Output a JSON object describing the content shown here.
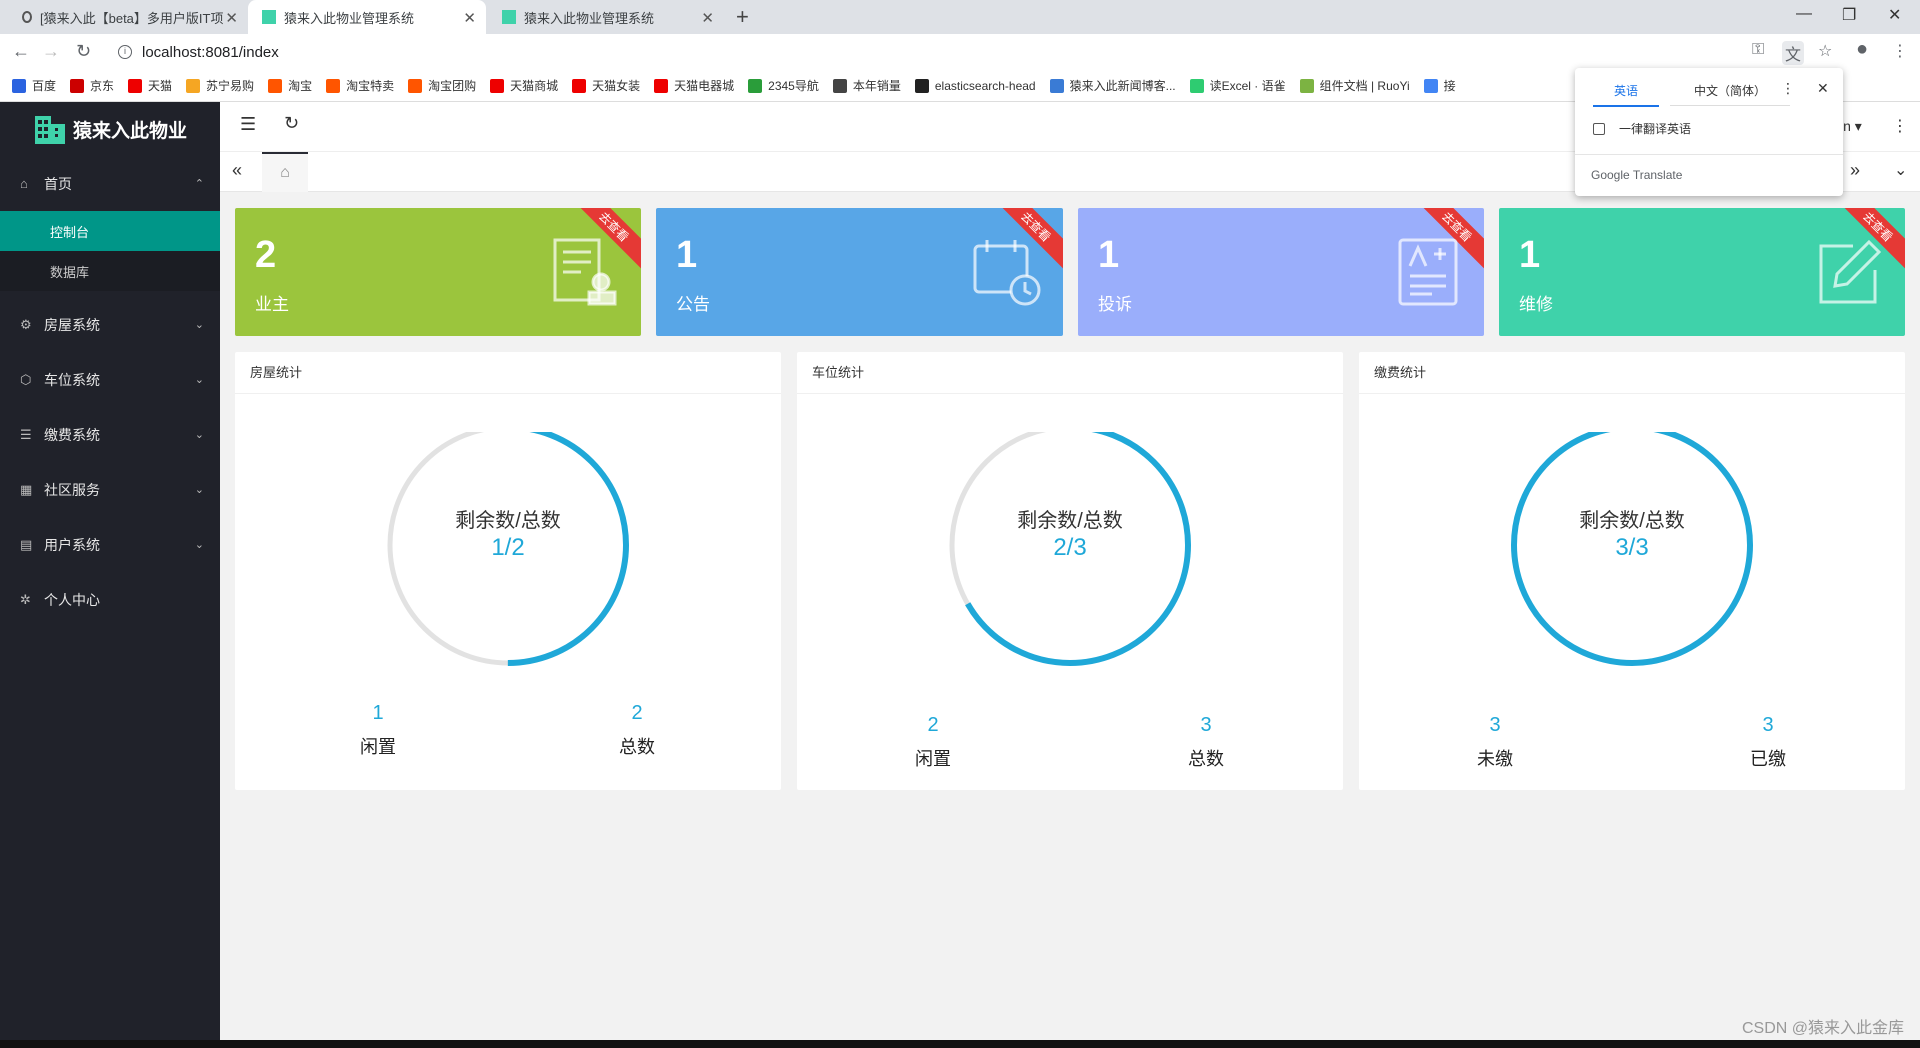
{
  "browser": {
    "tabs": [
      {
        "title": "[猿来入此【beta】多用户版IT项"
      },
      {
        "title": "猿来入此物业管理系统"
      },
      {
        "title": "猿来入此物业管理系统"
      }
    ],
    "url": "localhost:8081/index",
    "bookmarks": [
      "百度",
      "京东",
      "天猫",
      "苏宁易购",
      "淘宝",
      "淘宝特卖",
      "淘宝团购",
      "天猫商城",
      "天猫女装",
      "天猫电器城",
      "2345导航",
      "本年销量",
      "elasticsearch-head",
      "猿来入此新闻博客...",
      "读Excel · 语雀",
      "组件文档 | RuoYi",
      "接"
    ]
  },
  "translate_popup": {
    "tab_source": "英语",
    "tab_target": "中文（简体）",
    "checkbox_label": "一律翻译英语",
    "brand": "Google Translate"
  },
  "app": {
    "logo_text": "猿来入此物业",
    "menu": [
      {
        "label": "首页",
        "icon": "home-icon"
      },
      {
        "label": "房屋系统",
        "icon": "gear-icon"
      },
      {
        "label": "车位系统",
        "icon": "cube-icon"
      },
      {
        "label": "缴费系统",
        "icon": "list-icon"
      },
      {
        "label": "社区服务",
        "icon": "apps-icon"
      },
      {
        "label": "用户系统",
        "icon": "user-grid-icon"
      },
      {
        "label": "个人中心",
        "icon": "settings-icon"
      }
    ],
    "submenu": [
      "控制台",
      "数据库"
    ],
    "user_suffix": "in"
  },
  "cards": [
    {
      "num": "2",
      "label": "业主",
      "ribbon": "去查看",
      "color": "#9bc53d"
    },
    {
      "num": "1",
      "label": "公告",
      "ribbon": "去查看",
      "color": "#58a6e7"
    },
    {
      "num": "1",
      "label": "投诉",
      "ribbon": "去查看",
      "color": "#9aaefb"
    },
    {
      "num": "1",
      "label": "维修",
      "ribbon": "去查看",
      "color": "#3fd2aa"
    }
  ],
  "panels": [
    {
      "title": "房屋统计",
      "ring_label": "剩余数/总数",
      "ring_value": "1/2",
      "fraction": 0.5,
      "left_value": "1",
      "left_label": "闲置",
      "right_value": "2",
      "right_label": "总数"
    },
    {
      "title": "车位统计",
      "ring_label": "剩余数/总数",
      "ring_value": "2/3",
      "fraction": 0.6667,
      "left_value": "2",
      "left_label": "闲置",
      "right_value": "3",
      "right_label": "总数"
    },
    {
      "title": "缴费统计",
      "ring_label": "剩余数/总数",
      "ring_value": "3/3",
      "fraction": 1.0,
      "left_value": "3",
      "left_label": "未缴",
      "right_value": "3",
      "right_label": "已缴"
    }
  ],
  "watermark": "CSDN @猿来入此金库",
  "colors": {
    "accent": "#1fa8d8",
    "sidebar": "#20222a",
    "active": "#009688"
  }
}
